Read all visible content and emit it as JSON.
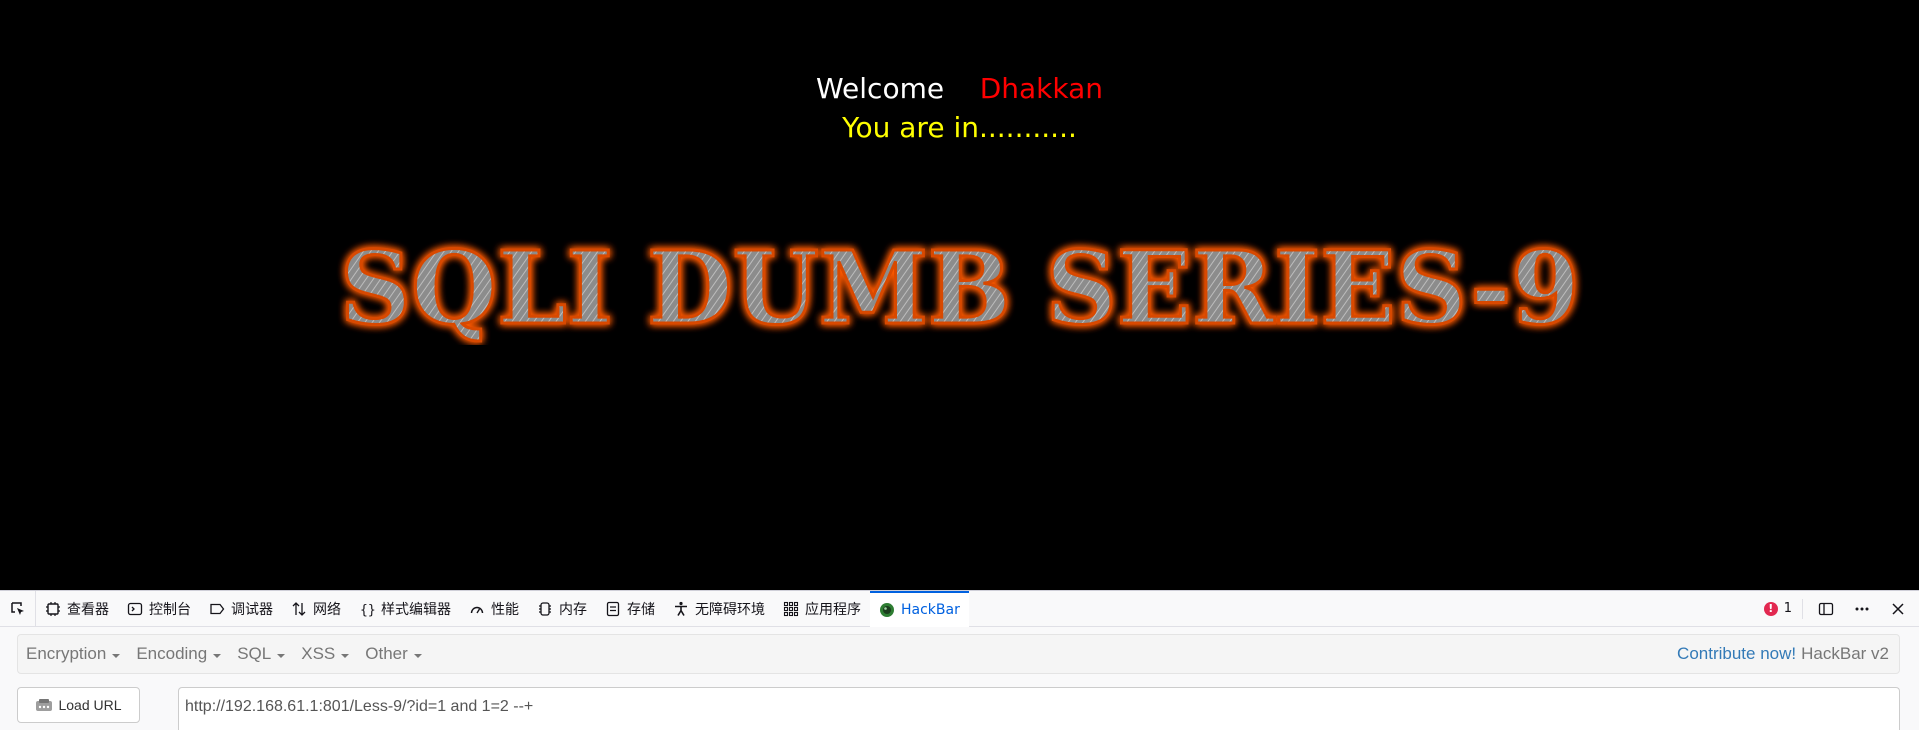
{
  "page": {
    "welcome_word": "Welcome",
    "welcome_name": "Dhakkan",
    "status": "You are in...........",
    "banner_text": "SQLI DUMB SERIES-9",
    "colors": {
      "welcome": "#ffffff",
      "name": "#ff0000",
      "status": "#ffff00",
      "banner_glow": "#ff5a00"
    }
  },
  "devtools": {
    "tabs": [
      {
        "label": "查看器",
        "icon": "inspector-icon"
      },
      {
        "label": "控制台",
        "icon": "console-icon"
      },
      {
        "label": "调试器",
        "icon": "debugger-icon"
      },
      {
        "label": "网络",
        "icon": "network-icon"
      },
      {
        "label": "样式编辑器",
        "icon": "style-editor-icon"
      },
      {
        "label": "性能",
        "icon": "performance-icon"
      },
      {
        "label": "内存",
        "icon": "memory-icon"
      },
      {
        "label": "存储",
        "icon": "storage-icon"
      },
      {
        "label": "无障碍环境",
        "icon": "accessibility-icon"
      },
      {
        "label": "应用程序",
        "icon": "application-icon"
      },
      {
        "label": "HackBar",
        "icon": "hackbar-icon"
      }
    ],
    "active_tab": "HackBar",
    "error_count": "1"
  },
  "hackbar": {
    "menus": [
      "Encryption",
      "Encoding",
      "SQL",
      "XSS",
      "Other"
    ],
    "contribute": "Contribute now!",
    "version": "HackBar v2",
    "load_url": "Load URL",
    "url": "http://192.168.61.1:801/Less-9/?id=1 and 1=2 --+"
  }
}
